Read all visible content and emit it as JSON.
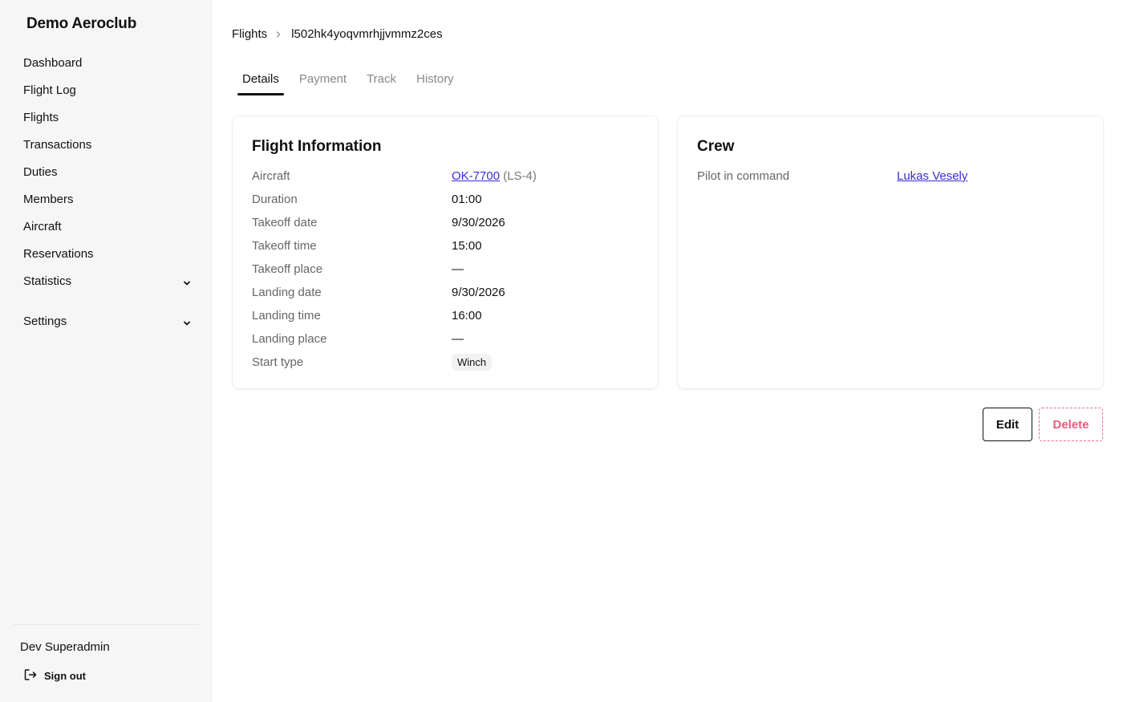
{
  "sidebar": {
    "brand": "Demo Aeroclub",
    "items": [
      {
        "label": "Dashboard"
      },
      {
        "label": "Flight Log"
      },
      {
        "label": "Flights"
      },
      {
        "label": "Transactions"
      },
      {
        "label": "Duties"
      },
      {
        "label": "Members"
      },
      {
        "label": "Aircraft"
      },
      {
        "label": "Reservations"
      },
      {
        "label": "Statistics",
        "icon": "chevron-down-icon"
      },
      {
        "label": "Settings",
        "icon": "chevron-down-icon"
      }
    ],
    "user_name": "Dev Superadmin",
    "sign_out": "Sign out"
  },
  "breadcrumb": {
    "parent": "Flights",
    "current": "l502hk4yoqvmrhjjvmmz2ces"
  },
  "tabs": [
    {
      "label": "Details",
      "active": true
    },
    {
      "label": "Payment",
      "active": false
    },
    {
      "label": "Track",
      "active": false
    },
    {
      "label": "History",
      "active": false
    }
  ],
  "flight_info": {
    "title": "Flight Information",
    "aircraft_label": "Aircraft",
    "aircraft_reg": "OK-7700",
    "aircraft_type": "(LS-4)",
    "duration_label": "Duration",
    "duration": "01:00",
    "takeoff_date_label": "Takeoff date",
    "takeoff_date": "9/30/2026",
    "takeoff_time_label": "Takeoff time",
    "takeoff_time": "15:00",
    "takeoff_place_label": "Takeoff place",
    "takeoff_place": "—",
    "landing_date_label": "Landing date",
    "landing_date": "9/30/2026",
    "landing_time_label": "Landing time",
    "landing_time": "16:00",
    "landing_place_label": "Landing place",
    "landing_place": "—",
    "start_type_label": "Start type",
    "start_type": "Winch"
  },
  "crew": {
    "title": "Crew",
    "pic_label": "Pilot in command",
    "pic_name": "Lukas Vesely"
  },
  "actions": {
    "edit": "Edit",
    "delete": "Delete"
  },
  "colors": {
    "link": "#3b2bd6",
    "danger": "#ef5a7d",
    "sidebar_bg": "#f6f6f6"
  }
}
